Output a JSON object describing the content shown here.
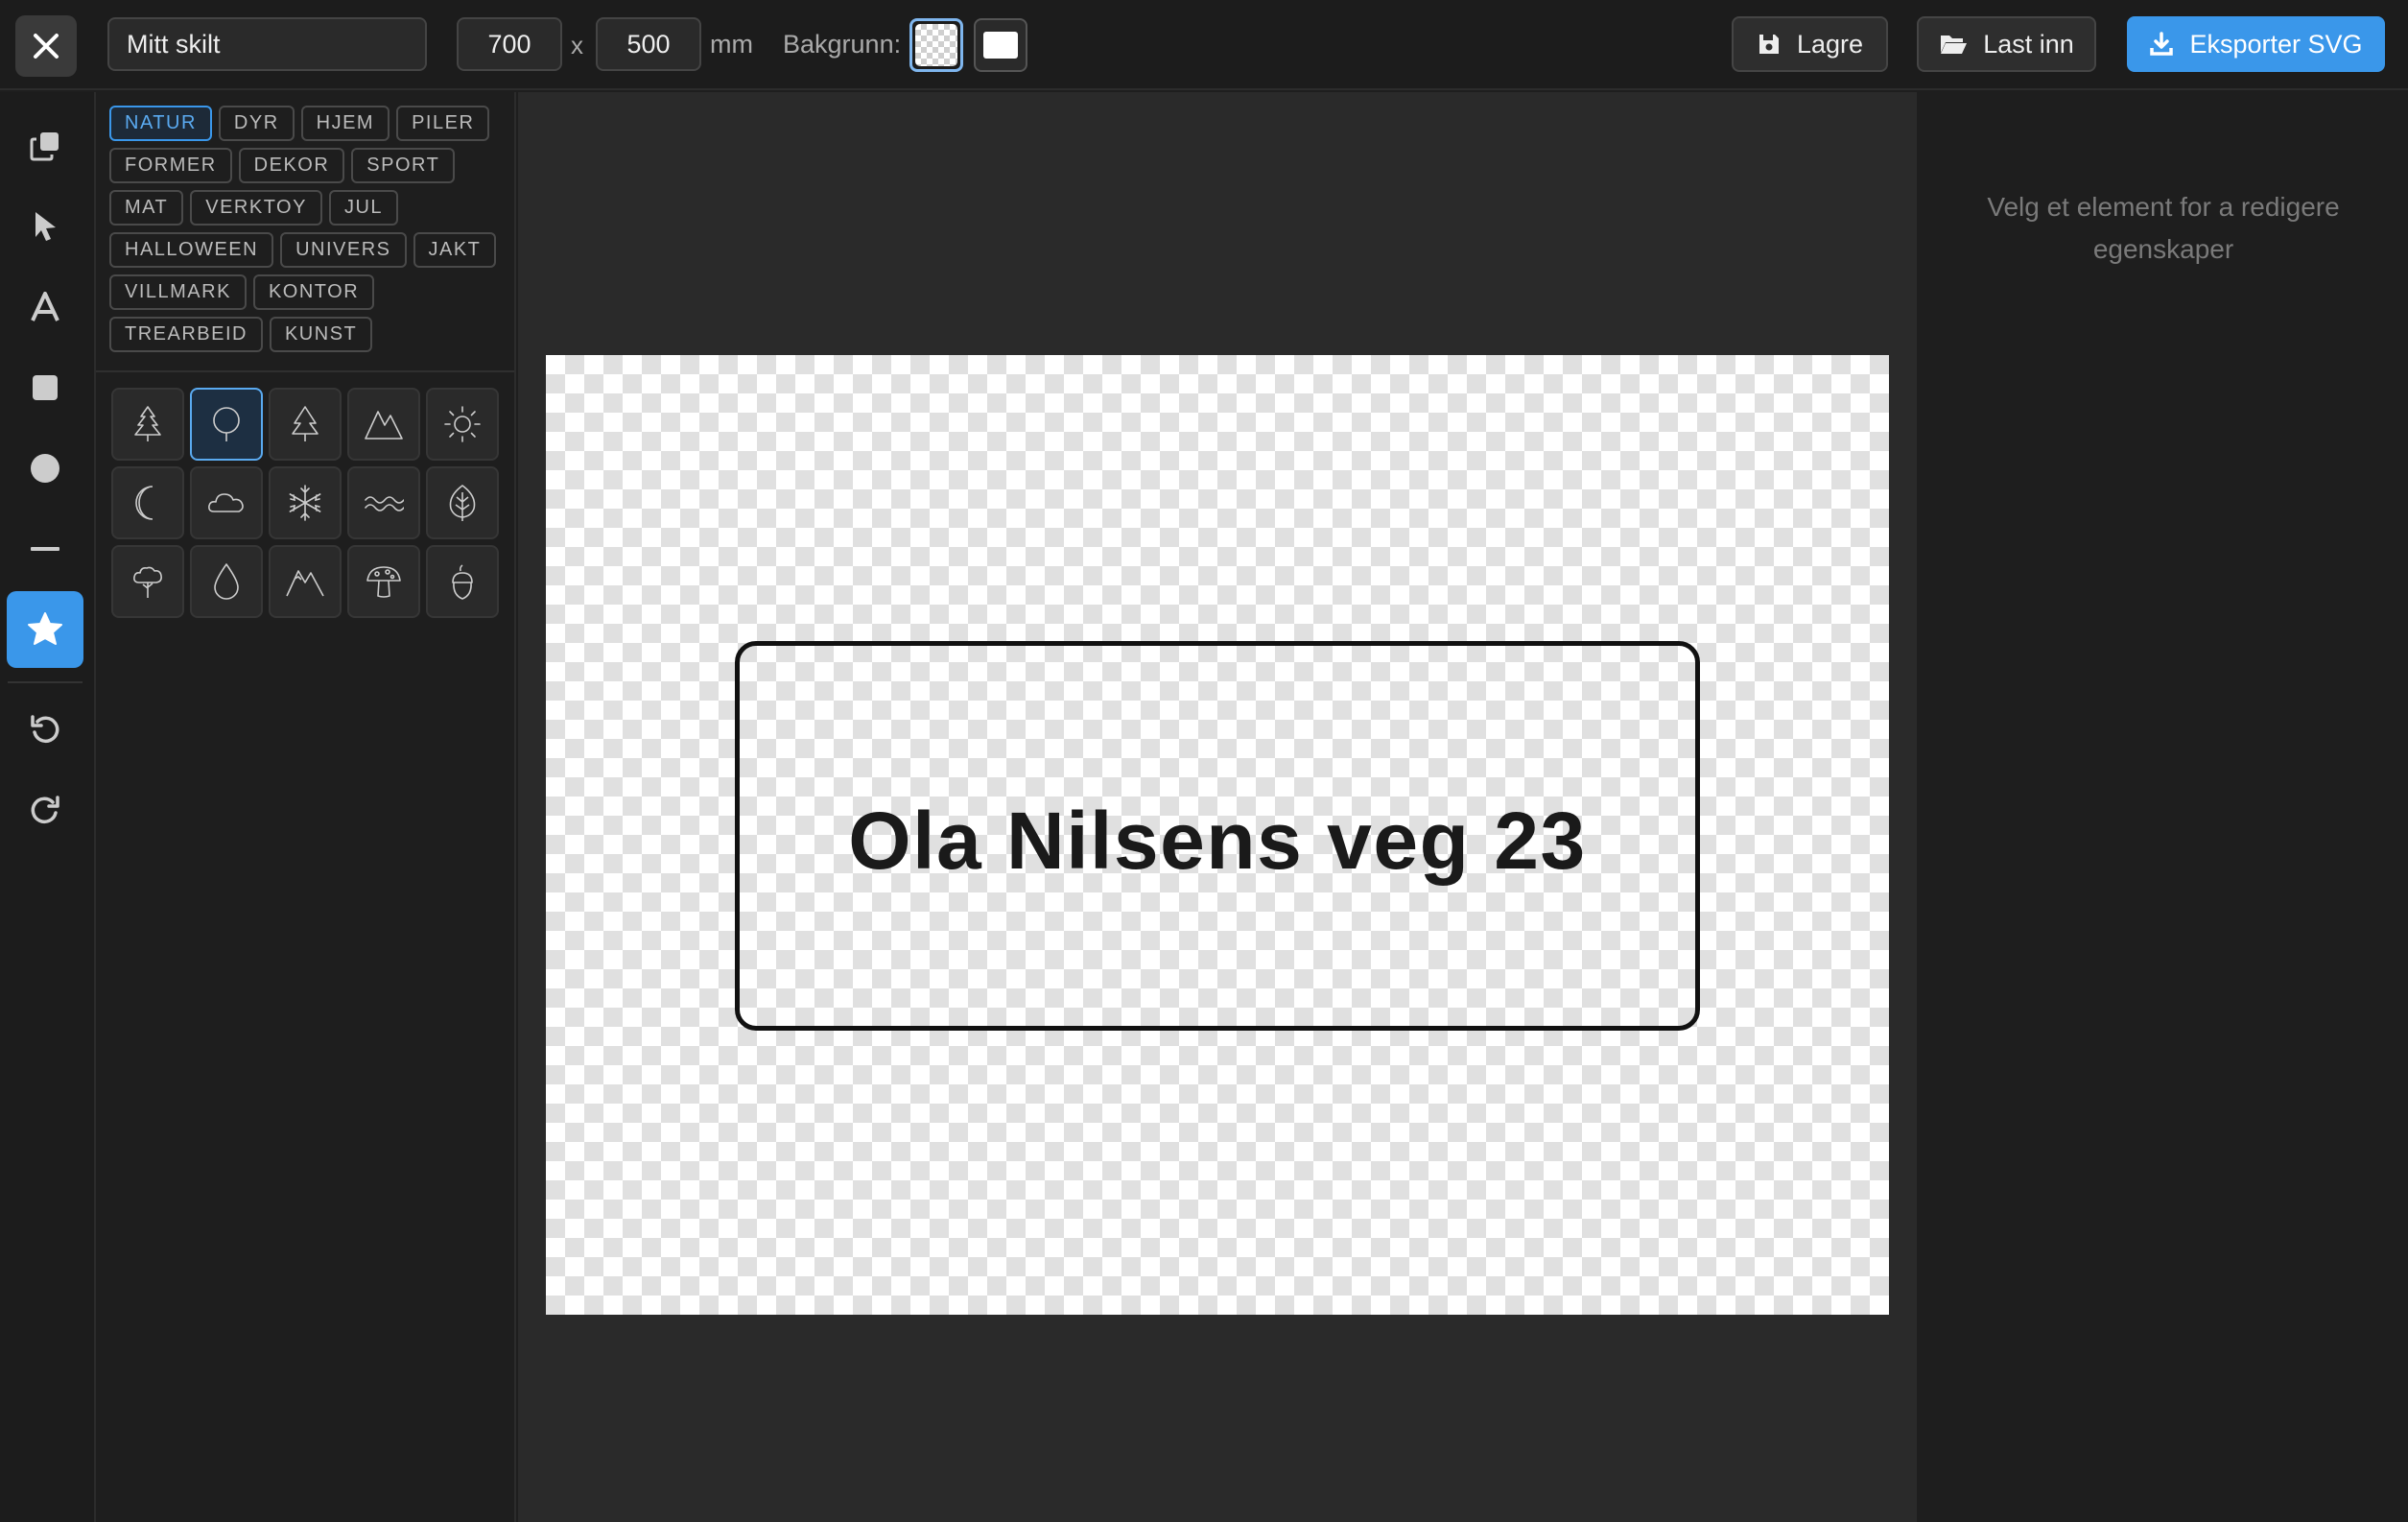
{
  "project": {
    "name": "Mitt skilt"
  },
  "dimensions": {
    "width": "700",
    "separator": "x",
    "height": "500",
    "unit": "mm"
  },
  "background": {
    "label": "Bakgrunn:",
    "options": [
      "transparent",
      "white"
    ],
    "selected": "transparent"
  },
  "actions": {
    "save_label": "Lagre",
    "load_label": "Last inn",
    "export_label": "Eksporter SVG"
  },
  "tools": [
    "duplicate-icon",
    "select-icon",
    "text-icon",
    "rectangle-icon",
    "circle-icon",
    "line-icon",
    "star-icon",
    "undo-icon",
    "redo-icon"
  ],
  "active_tool": "star-icon",
  "library": {
    "categories": [
      "NATUR",
      "DYR",
      "HJEM",
      "PILER",
      "FORMER",
      "DEKOR",
      "SPORT",
      "MAT",
      "VERKTOY",
      "JUL",
      "HALLOWEEN",
      "UNIVERS",
      "JAKT",
      "VILLMARK",
      "KONTOR",
      "TREARBEID",
      "KUNST"
    ],
    "active_category": "NATUR",
    "icons": [
      "pine-tree-icon",
      "deciduous-tree-icon",
      "spruce-icon",
      "mountain-icon",
      "sun-icon",
      "moon-icon",
      "cloud-icon",
      "snowflake-icon",
      "wave-icon",
      "leaf-icon",
      "bush-icon",
      "water-drop-icon",
      "mountain-peaks-icon",
      "mushroom-icon",
      "acorn-icon"
    ],
    "selected_icon": "deciduous-tree-icon"
  },
  "canvas": {
    "sign_text": "Ola Nilsens veg 23"
  },
  "properties": {
    "empty_hint": "Velg et element for a redigere egenskaper"
  },
  "colors": {
    "accent": "#3a97ea",
    "background": "#1e1e1e",
    "canvas_area": "#2a2a2a"
  }
}
